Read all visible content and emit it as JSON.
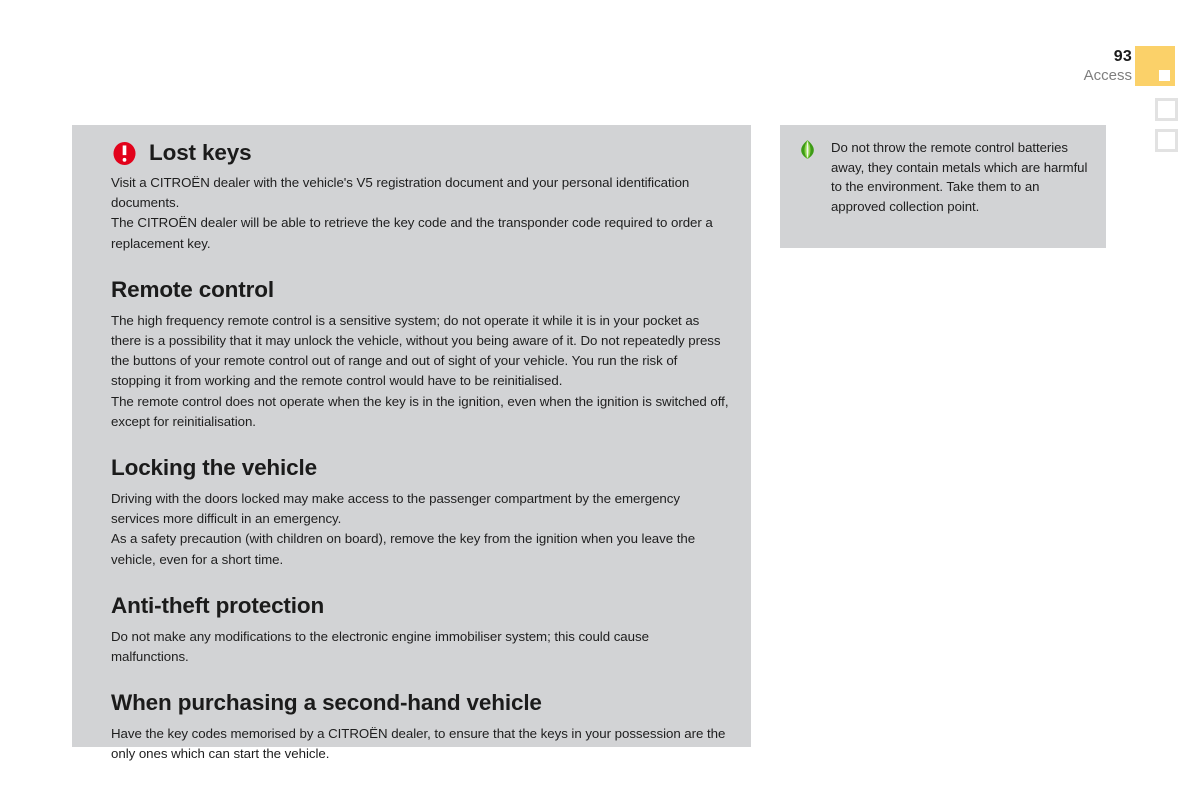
{
  "header": {
    "page_number": "93",
    "section_name": "Access",
    "accent_color": "#fbd169",
    "tab_rail": {
      "active_label": "access-tab",
      "inactive_count": 2
    }
  },
  "main": {
    "panel_color": "#d2d3d5",
    "blocks": [
      {
        "icon": "warning-icon",
        "icon_color": "#e2021b",
        "heading": "Lost keys",
        "paragraphs": [
          "Visit a CITROËN dealer with the vehicle's V5 registration document and your personal identification documents.",
          "The CITROËN dealer will be able to retrieve the key code and the transponder code required to order a replacement key."
        ]
      },
      {
        "icon": null,
        "heading": "Remote control",
        "paragraphs": [
          "The high frequency remote control is a sensitive system; do not operate it while it is in your pocket as there is a possibility that it may unlock the vehicle, without you being aware of it. Do not repeatedly press the buttons of your remote control out of range and out of sight of your vehicle. You run the risk of stopping it from working and the remote control would have to be reinitialised.",
          "The remote control does not operate when the key is in the ignition, even when the ignition is switched off, except for reinitialisation."
        ]
      },
      {
        "icon": null,
        "heading": "Locking the vehicle",
        "paragraphs": [
          "Driving with the doors locked may make access to the passenger compartment by the emergency services more difficult in an emergency.",
          "As a safety precaution (with children on board), remove the key from the ignition when you leave the vehicle, even for a short time."
        ]
      },
      {
        "icon": null,
        "heading": "Anti-theft protection",
        "paragraphs": [
          "Do not make any modifications to the electronic engine immobiliser system; this could cause malfunctions."
        ]
      },
      {
        "icon": null,
        "heading": "When purchasing a second-hand vehicle",
        "paragraphs": [
          "Have the key codes memorised by a CITROËN dealer, to ensure that the keys in your possession are the only ones which can start the vehicle."
        ]
      }
    ]
  },
  "note": {
    "panel_color": "#d2d3d5",
    "icon": "eco-leaf-icon",
    "icon_color": "#4caf23",
    "text": "Do not throw the remote control batteries away, they contain metals which are harmful to the environment. Take them to an approved collection point."
  }
}
